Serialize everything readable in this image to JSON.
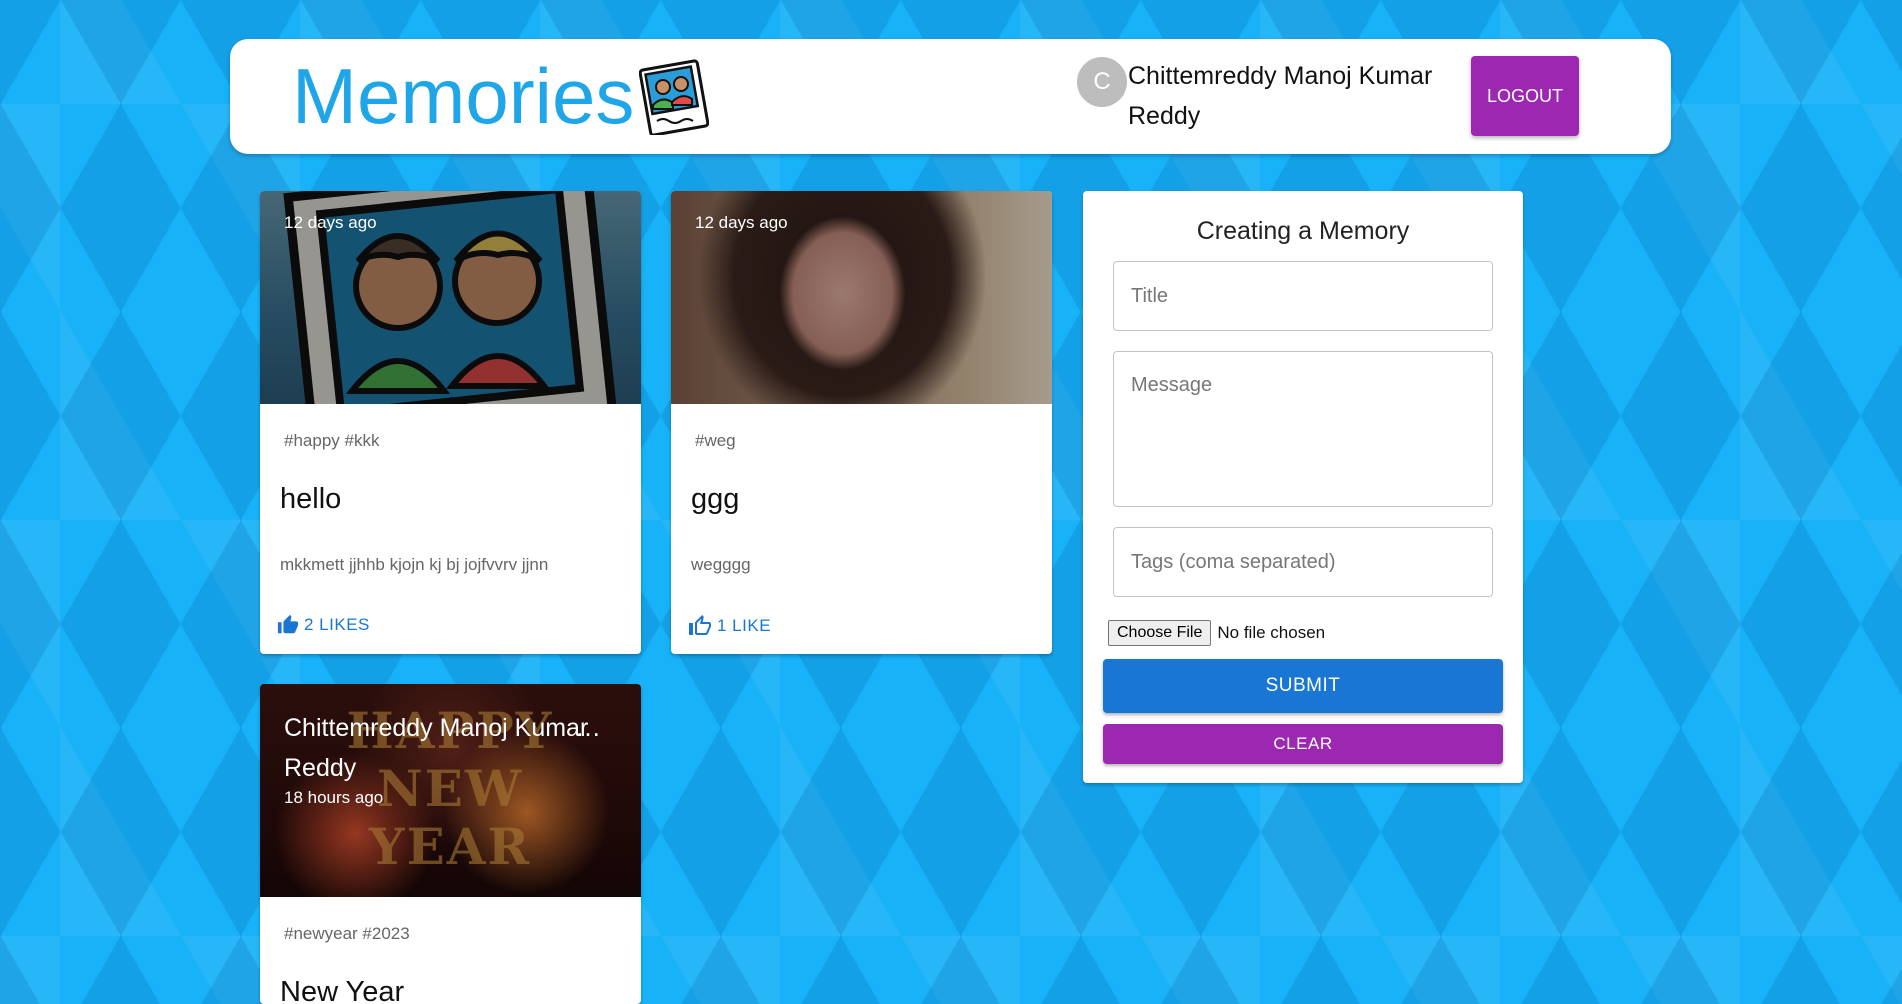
{
  "header": {
    "brand_title": "Memories",
    "brand_icon": "memories-photo-icon",
    "user": {
      "avatar_initial": "C",
      "name": "Chittemreddy Manoj Kumar Reddy"
    },
    "logout_label": "LOGOUT"
  },
  "posts": [
    {
      "time": "12 days ago",
      "tags": "#happy #kkk",
      "title": "hello",
      "message": "mkkmett jjhhb kjojn kj bj jojfvvrv jjnn",
      "likes_label": "2 LIKES",
      "like_icon": "thumb-up-filled-icon"
    },
    {
      "time": "12 days ago",
      "tags": "#weg",
      "title": "ggg",
      "message": "wegggg",
      "likes_label": "1 LIKE",
      "like_icon": "thumb-up-outline-icon"
    },
    {
      "creator": "Chittemreddy Manoj Kumar Reddy",
      "time": "18 hours ago",
      "tags": "#newyear #2023",
      "title": "New Year",
      "image_text": "HAPPY NEW YEAR"
    }
  ],
  "form": {
    "heading": "Creating a Memory",
    "title_placeholder": "Title",
    "message_placeholder": "Message",
    "tags_placeholder": "Tags (coma separated)",
    "choose_file_label": "Choose File",
    "file_status": "No file chosen",
    "submit_label": "SUBMIT",
    "clear_label": "CLEAR"
  },
  "colors": {
    "background": "#17b2f7",
    "brand": "#1fa6e8",
    "primary": "#1976d2",
    "secondary": "#9c27b0"
  }
}
